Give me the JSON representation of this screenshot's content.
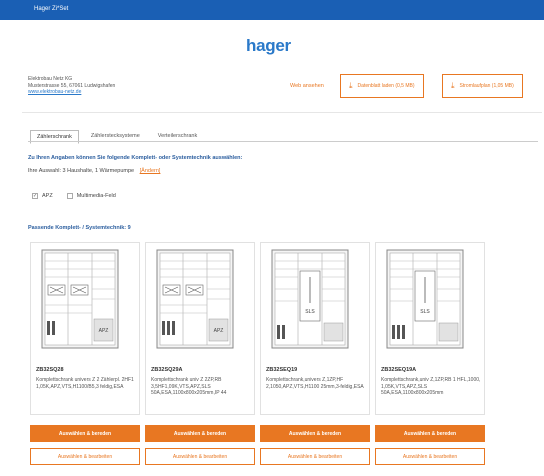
{
  "topbar": {
    "title": "Hager Zi*Set"
  },
  "brand": {
    "logo": "hager"
  },
  "company": {
    "name": "Elektrobau Netz KG",
    "address": "Musterstrasse 55, 67061 Ludwigshafen",
    "website": "www.elektrobau-netz.de"
  },
  "header": {
    "web_link": "Web ansehen",
    "buttons": [
      {
        "icon": "download-icon",
        "label": "Datenblatt laden (0,5 MB)"
      },
      {
        "icon": "download-icon",
        "label": "Stromlaufplan (1,05 MB)"
      }
    ]
  },
  "tabs": [
    {
      "label": "Zählerschrank",
      "active": true
    },
    {
      "label": "Zählerstecksysteme",
      "active": false
    },
    {
      "label": "Verteilerschrank",
      "active": false
    }
  ],
  "question": "Zu Ihren Angaben können Sie folgende Komplett- oder Systemtechnik auswählen:",
  "selection": {
    "text": "Ihre Auswahl: 3 Haushalte, 1 Wärmepumpe",
    "change_link": "[Ändern]"
  },
  "filters": [
    {
      "label": "APZ",
      "checked": true
    },
    {
      "label": "Multimedia-Feld",
      "checked": false
    }
  ],
  "results_title": "Passende Komplett- / Systemtechnik: 9",
  "products": [
    {
      "id": "ZB32SQ28",
      "desc": "Komplettschrank univers Z 2 Zählerpl. 2HF1 1,05K,APZ,VTS,H1100/B5,3 feldig,ESA",
      "feature": "APZ"
    },
    {
      "id": "ZB32SQ29A",
      "desc": "Komplettschrank univ Z 2ZP,RB 3,5HF1,09K,VTS,APZ,SLS 50A,ESA,1100x800x205mm,IP 44",
      "feature": "APZ"
    },
    {
      "id": "ZB32SEQ19",
      "desc": "Komplettschrank,univers Z,1ZP,HF 2,1050,APZ,VTS,H1100 25mm,3-feldig,ESA",
      "feature": "SLS"
    },
    {
      "id": "ZB32SEQ19A",
      "desc": "Komplettschrank,univ Z,1ZP,RB 1 HFL,1000, 1,05K,VTS,APZ,SLS 50A,ESA,1100x800x205mm",
      "feature": "SLS"
    }
  ],
  "actions": {
    "primary": "Auswählen & bereden",
    "secondary": "Auswählen & bearbeiten"
  },
  "colors": {
    "accent": "#e87722",
    "brand": "#2a79c9",
    "topbar": "#1a5fb4"
  }
}
